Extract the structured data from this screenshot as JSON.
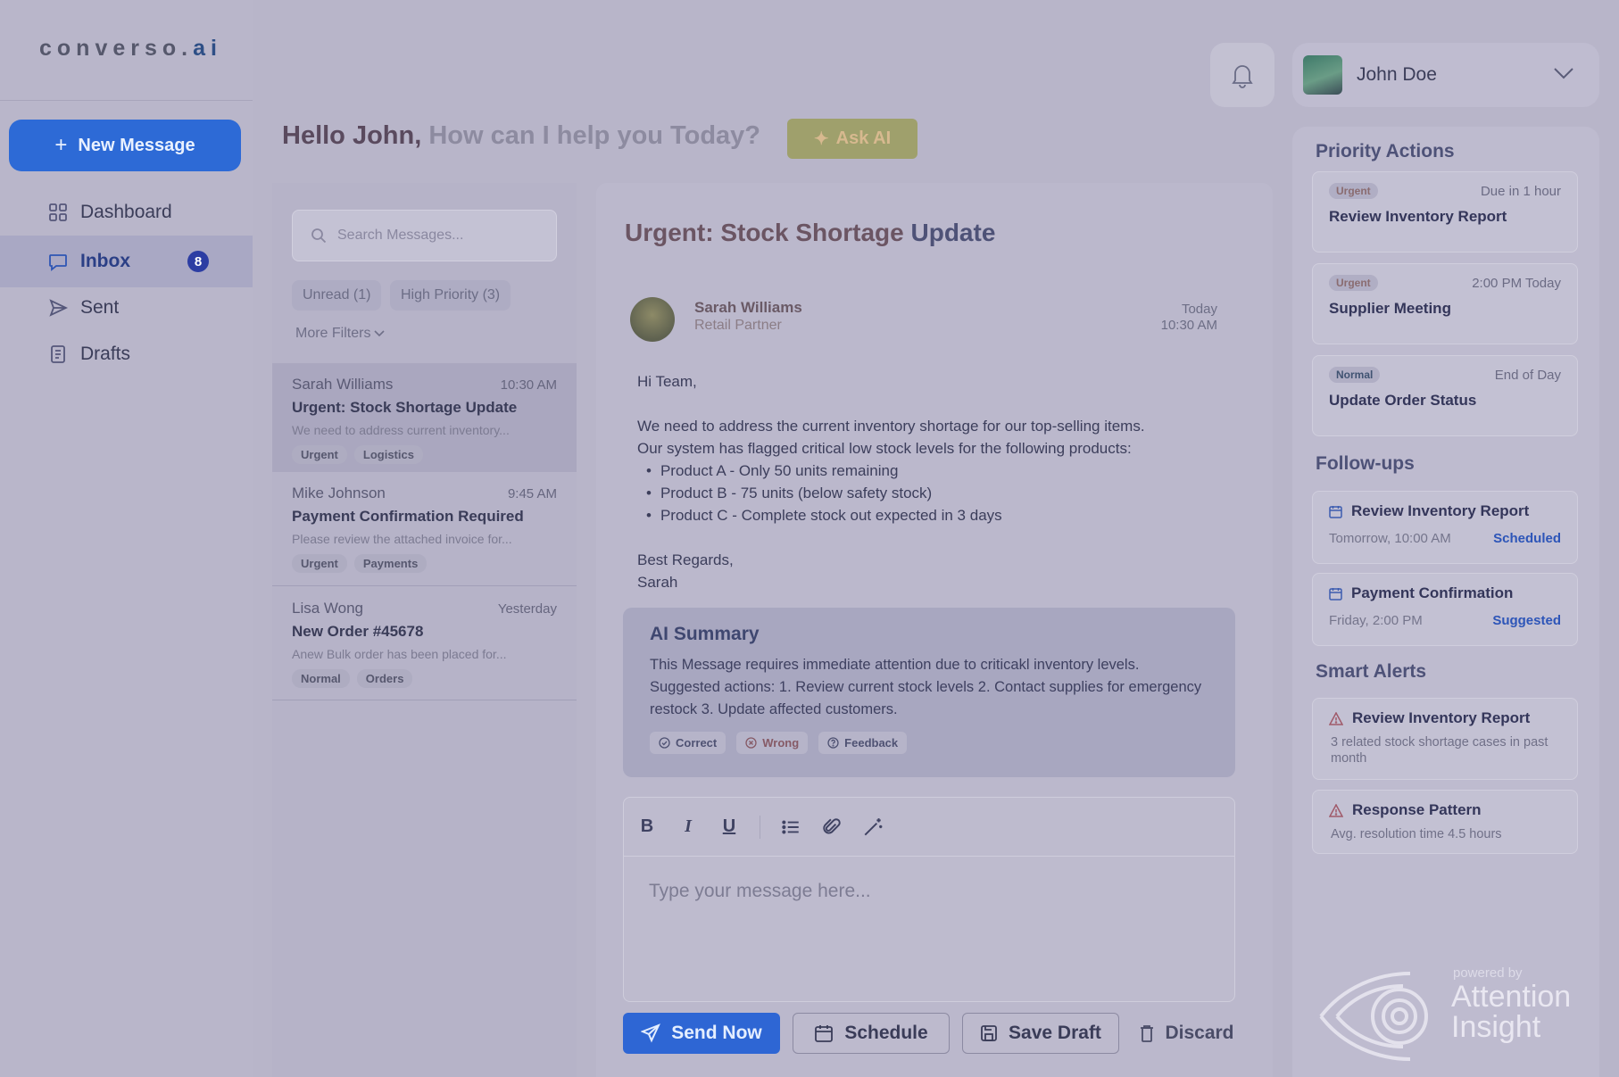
{
  "sidebar": {
    "logo_main": "converso.",
    "logo_suffix": "ai",
    "new_message_label": "New Message",
    "items": [
      {
        "label": "Dashboard",
        "icon": "grid-icon"
      },
      {
        "label": "Inbox",
        "icon": "chat-icon",
        "badge": "8",
        "active": true
      },
      {
        "label": "Sent",
        "icon": "send-icon"
      },
      {
        "label": "Drafts",
        "icon": "document-icon"
      }
    ]
  },
  "header": {
    "greeting_name": "Hello John,",
    "greeting_rest": "How can I help you Today?",
    "ask_ai_label": "Ask AI",
    "user_name": "John Doe"
  },
  "list": {
    "search_placeholder": "Search Messages...",
    "filters": [
      "Unread (1)",
      "High Priority (3)"
    ],
    "more_filters": "More Filters",
    "messages": [
      {
        "sender": "Sarah Williams",
        "time": "10:30 AM",
        "subject": "Urgent: Stock Shortage Update",
        "preview": "We need to address current inventory...",
        "tags": [
          "Urgent",
          "Logistics"
        ]
      },
      {
        "sender": "Mike Johnson",
        "time": "9:45 AM",
        "subject": "Payment Confirmation Required",
        "preview": "Please review the attached invoice for...",
        "tags": [
          "Urgent",
          "Payments"
        ]
      },
      {
        "sender": "Lisa Wong",
        "time": "Yesterday",
        "subject": "New Order #45678",
        "preview": "Anew Bulk order has been placed for...",
        "tags": [
          "Normal",
          "Orders"
        ]
      }
    ]
  },
  "email": {
    "subject_lead": "Urgent:",
    "subject_rest": "Stock Shortage",
    "subject_tail": "Update",
    "sender": "Sarah Williams",
    "role": "Retail Partner",
    "date": "Today",
    "time": "10:30 AM",
    "greeting": "Hi Team,",
    "para1": "We need to address the current inventory shortage for our top-selling items.",
    "para2": "Our system has flagged critical low stock levels for the following products:",
    "bullets": [
      "Product A - Only 50 units remaining",
      "Product B - 75 units (below safety stock)",
      "Product C - Complete stock out expected in 3 days"
    ],
    "signoff": "Best Regards,",
    "signature": "Sarah"
  },
  "ai_summary": {
    "title": "AI Summary",
    "text": "This Message requires immediate attention due to criticakl inventory levels. Suggested actions: 1. Review current stock levels 2. Contact supplies for emergency restock 3. Update affected customers.",
    "correct": "Correct",
    "wrong": "Wrong",
    "feedback": "Feedback"
  },
  "composer": {
    "placeholder": "Type your message here...",
    "send": "Send Now",
    "schedule": "Schedule",
    "save_draft": "Save Draft",
    "discard": "Discard"
  },
  "right": {
    "priority_title": "Priority Actions",
    "priority": [
      {
        "tag": "Urgent",
        "due": "Due in 1 hour",
        "title": "Review Inventory Report"
      },
      {
        "tag": "Urgent",
        "due": "2:00 PM Today",
        "title": "Supplier Meeting"
      },
      {
        "tag": "Normal",
        "due": "End of Day",
        "title": "Update Order Status"
      }
    ],
    "followups_title": "Follow-ups",
    "followups": [
      {
        "title": "Review Inventory Report",
        "when": "Tomorrow, 10:00 AM",
        "status": "Scheduled"
      },
      {
        "title": "Payment Confirmation",
        "when": "Friday, 2:00 PM",
        "status": "Suggested"
      }
    ],
    "alerts_title": "Smart Alerts",
    "alerts": [
      {
        "title": "Review Inventory Report",
        "text": "3 related stock shortage cases in past month"
      },
      {
        "title": "Response Pattern",
        "text": "Avg. resolution time 4.5 hours"
      }
    ]
  },
  "watermark": {
    "powered_by": "powered by",
    "brand_line1": "Attention",
    "brand_line2": "Insight"
  }
}
